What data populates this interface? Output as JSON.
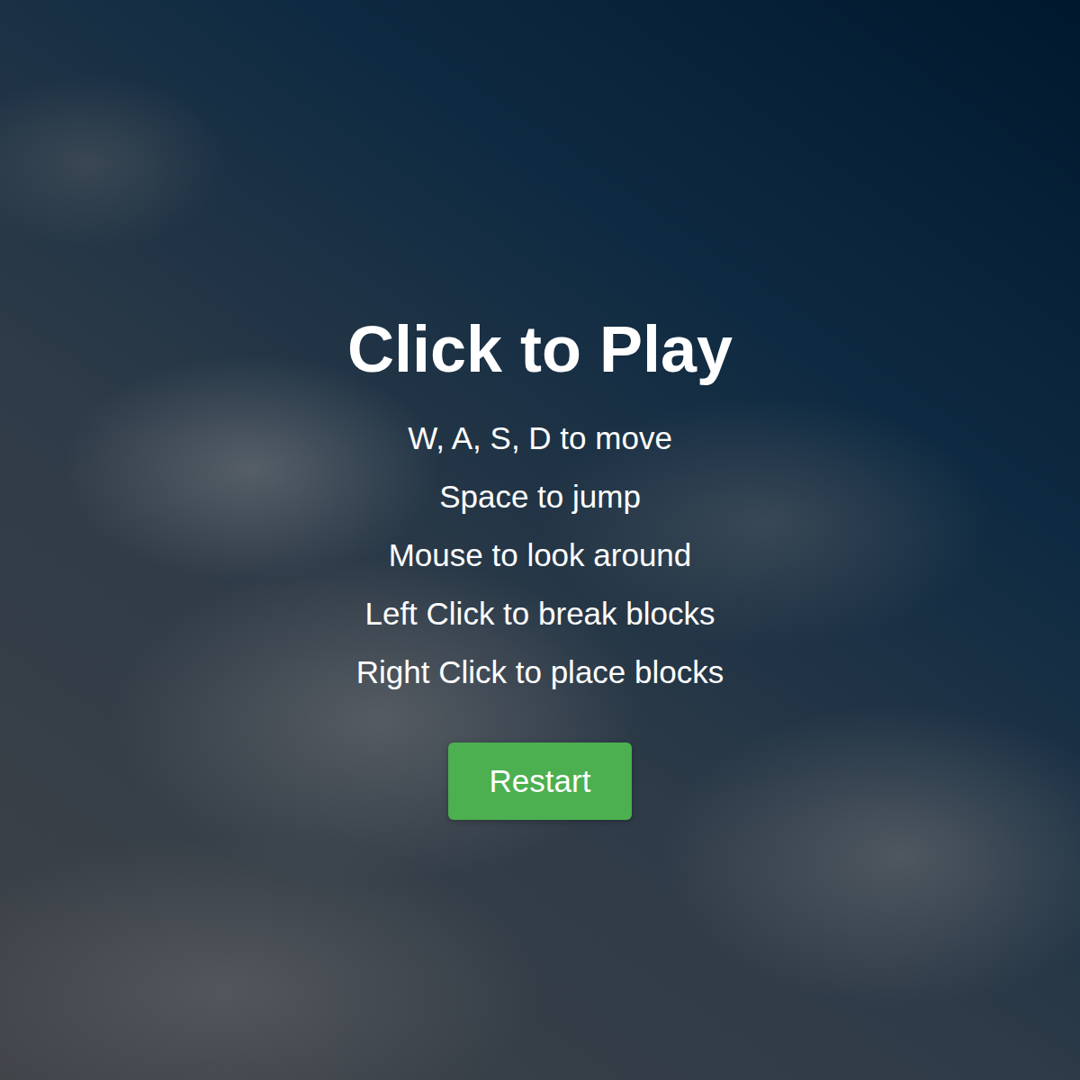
{
  "overlay": {
    "title": "Click to Play",
    "instructions": [
      "W, A, S, D to move",
      "Space to jump",
      "Mouse to look around",
      "Left Click to break blocks",
      "Right Click to place blocks"
    ],
    "button": {
      "label": "Restart"
    }
  }
}
